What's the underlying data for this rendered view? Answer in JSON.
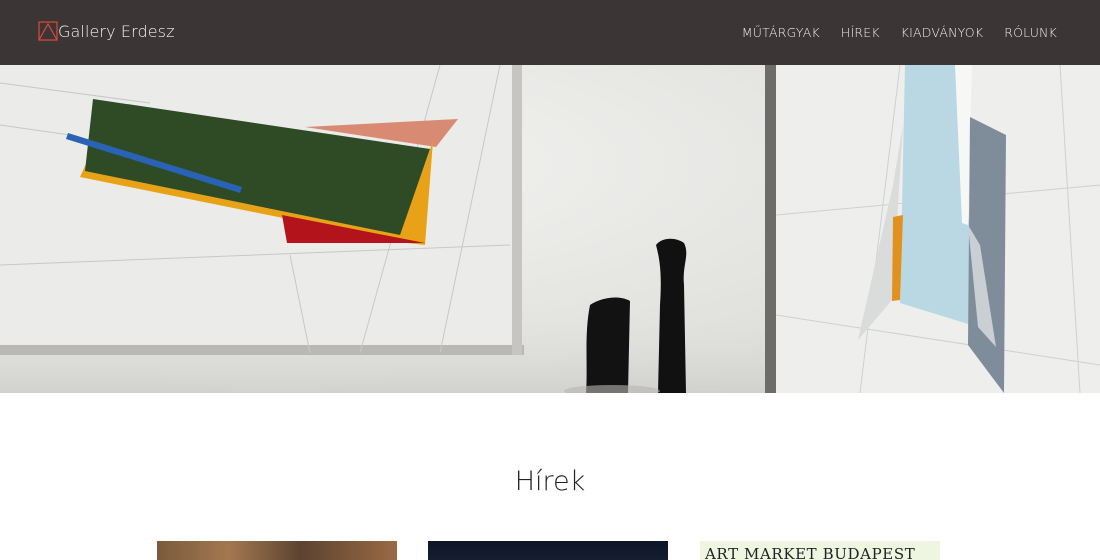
{
  "nav": {
    "brand": "Gallery Erdesz",
    "logo_icon": "triangle-logo-icon",
    "items": [
      {
        "label": "MŰTÁRGYAK"
      },
      {
        "label": "HÍREK"
      },
      {
        "label": "KIADVÁNYOK"
      },
      {
        "label": "RÓLUNK"
      }
    ],
    "colors": {
      "background": "#3b3536",
      "text": "#eeeeee",
      "logo": "#d84a3a"
    }
  },
  "hero": {
    "image": "gallery-wall-paintings-sculpture"
  },
  "news": {
    "title": "Hírek",
    "cards": [
      {
        "text": ""
      },
      {
        "text": ""
      },
      {
        "text": "ART MARKET BUDAPEST"
      }
    ]
  }
}
